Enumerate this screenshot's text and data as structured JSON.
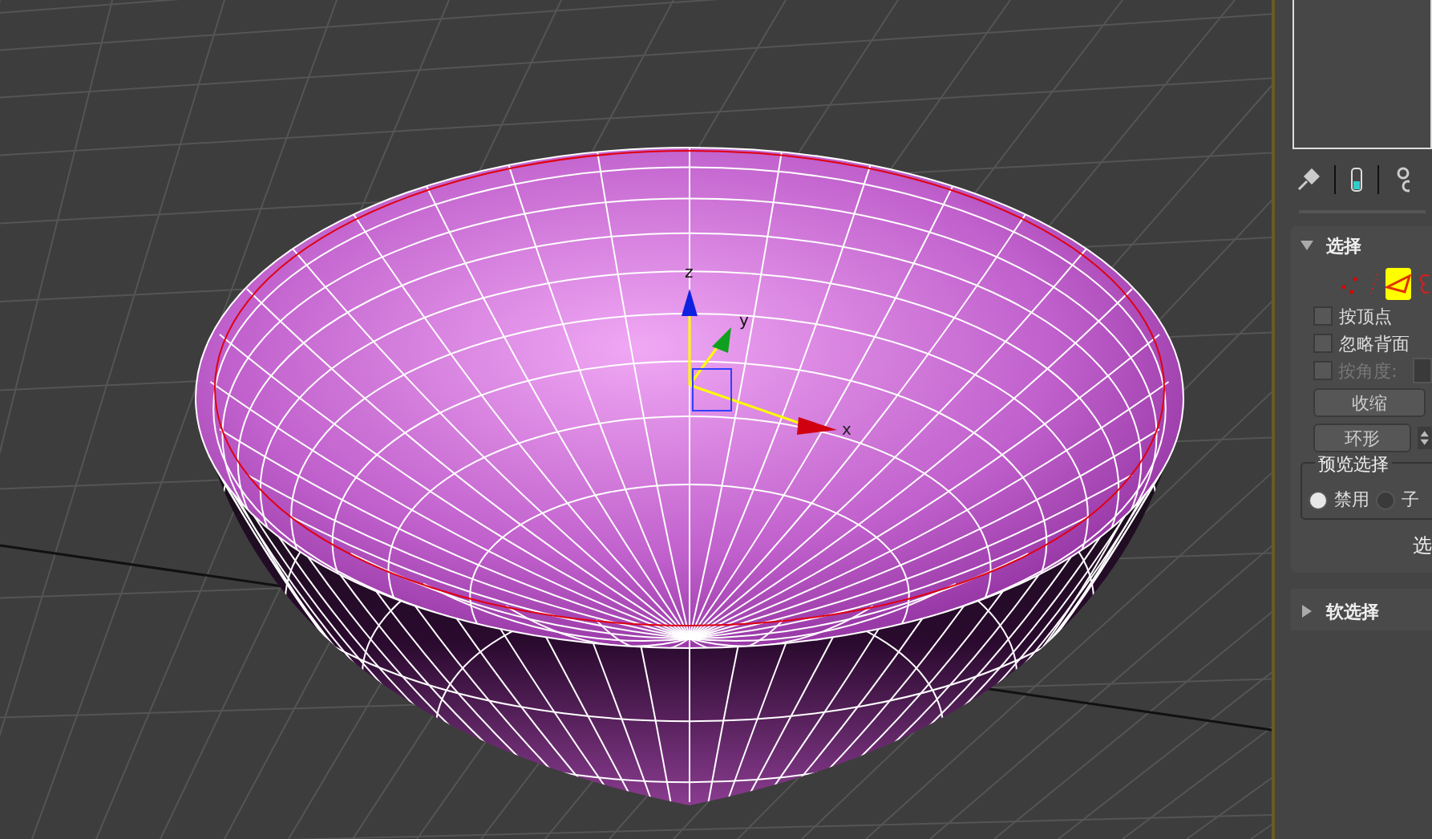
{
  "viewport": {
    "gizmo": {
      "z_label": "z",
      "y_label": "y",
      "x_label": "x"
    }
  },
  "command_panel": {
    "selection_rollout": {
      "title": "选择",
      "expanded": true,
      "subobject_modes": [
        {
          "kind": "vertex",
          "selected": false
        },
        {
          "kind": "edge",
          "selected": false
        },
        {
          "kind": "face",
          "selected": true
        },
        {
          "kind": "element",
          "selected": false
        }
      ],
      "checkboxes": [
        {
          "label": "按顶点",
          "checked": false,
          "disabled": false
        },
        {
          "label": "忽略背面",
          "checked": false,
          "disabled": false
        },
        {
          "label": "按角度:",
          "checked": false,
          "disabled": true
        }
      ],
      "shrink_button": "收缩",
      "ring_button": "环形",
      "preview_selection": {
        "title": "预览选择",
        "options": [
          {
            "label": "禁用",
            "selected": true
          },
          {
            "label": "子",
            "selected": false
          }
        ]
      },
      "cut_text": "选"
    },
    "soft_selection_rollout": {
      "title": "软选择",
      "expanded": false
    }
  }
}
